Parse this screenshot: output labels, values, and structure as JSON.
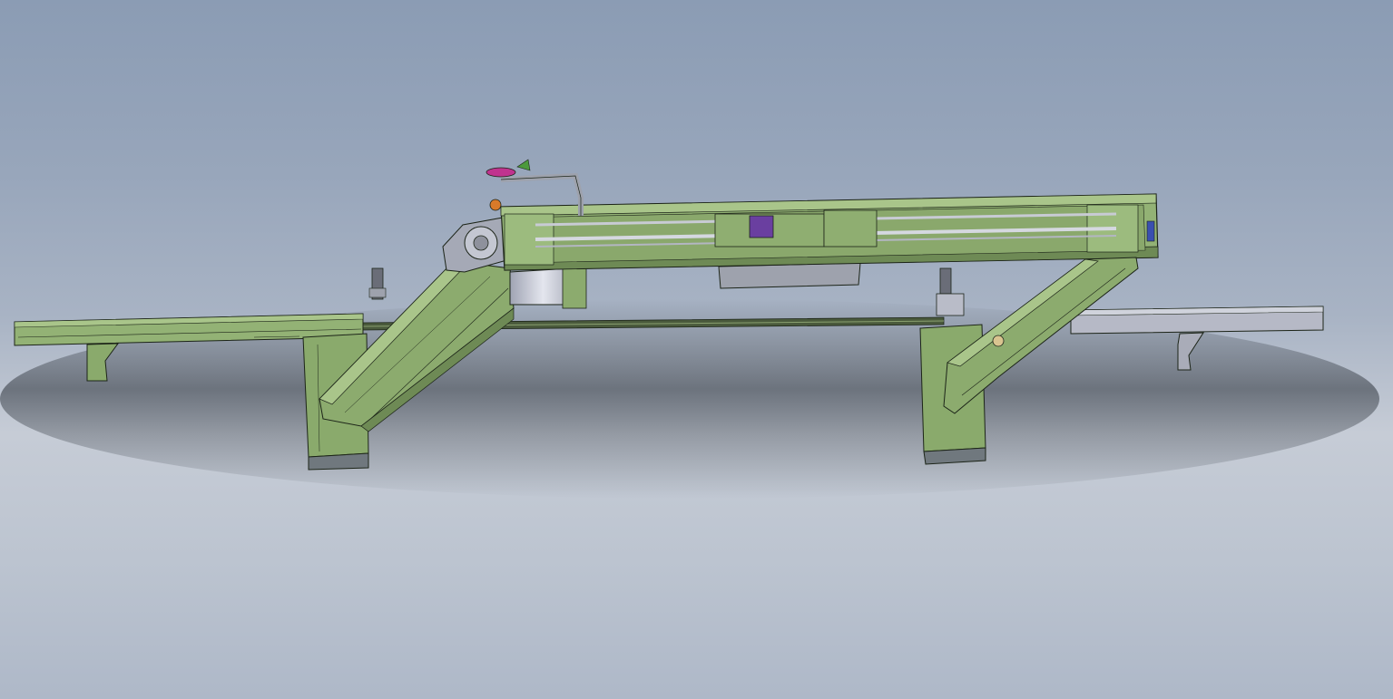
{
  "viewport": {
    "kind": "3d-cad-model-view",
    "background": "gradient",
    "colors": {
      "background_top": "#8b9cb4",
      "background_mid": "#c6ccd6",
      "background_bottom": "#aeb8c8",
      "frame_green": "#93b275",
      "frame_green_dark": "#6e8a55",
      "frame_green_light": "#a9c58a",
      "edge_line": "#1c2418",
      "steel_grey": "#b9bcc8",
      "steel_grey_dark": "#8e919c",
      "accent_magenta": "#c0338f",
      "accent_orange": "#d97a2a",
      "accent_purple": "#6a3fa0",
      "accent_blue": "#3a4fb0"
    }
  },
  "model": {
    "components": [
      "left-rail",
      "left-bracket",
      "left-stand",
      "diagonal-conveyor",
      "drive-motor",
      "drum-guard",
      "top-gantry-frame",
      "guide-rods",
      "carriage",
      "lower-hood",
      "actuator-bracket",
      "right-stand",
      "right-diagonal-arm",
      "right-rail",
      "right-bracket",
      "cylinder-left",
      "cylinder-right"
    ]
  }
}
